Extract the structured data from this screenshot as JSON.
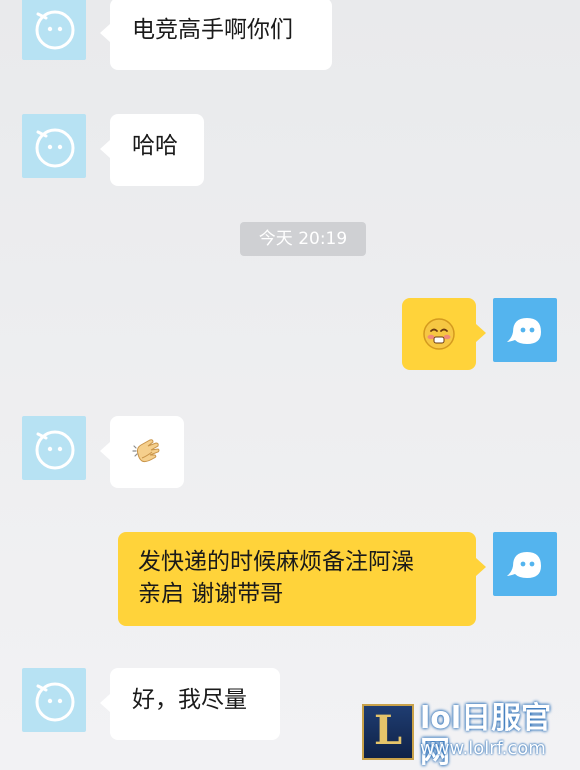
{
  "messages": [
    {
      "side": "in",
      "text": "电竞高手啊你们"
    },
    {
      "side": "in",
      "text": "哈哈"
    },
    {
      "side": "out",
      "emoji": "blushing-face-emoji"
    },
    {
      "side": "in",
      "emoji": "clapping-hands-emoji"
    },
    {
      "side": "out",
      "text_lines": [
        "发快递的时候麻烦备注阿澡",
        "亲启 谢谢带哥"
      ]
    },
    {
      "side": "in",
      "text": "好，我尽量"
    }
  ],
  "timestamp": "今天 20:19",
  "watermark": {
    "logo_letter": "L",
    "title": "lol日服官网",
    "url": "www.lolrf.com"
  },
  "colors": {
    "background": "#ededef",
    "incoming_bubble": "#ffffff",
    "outgoing_bubble": "#ffd33a",
    "avatar_light": "#b7e2f3",
    "avatar_blue": "#54b4ee",
    "timestamp_bg": "#cfd0d3"
  }
}
